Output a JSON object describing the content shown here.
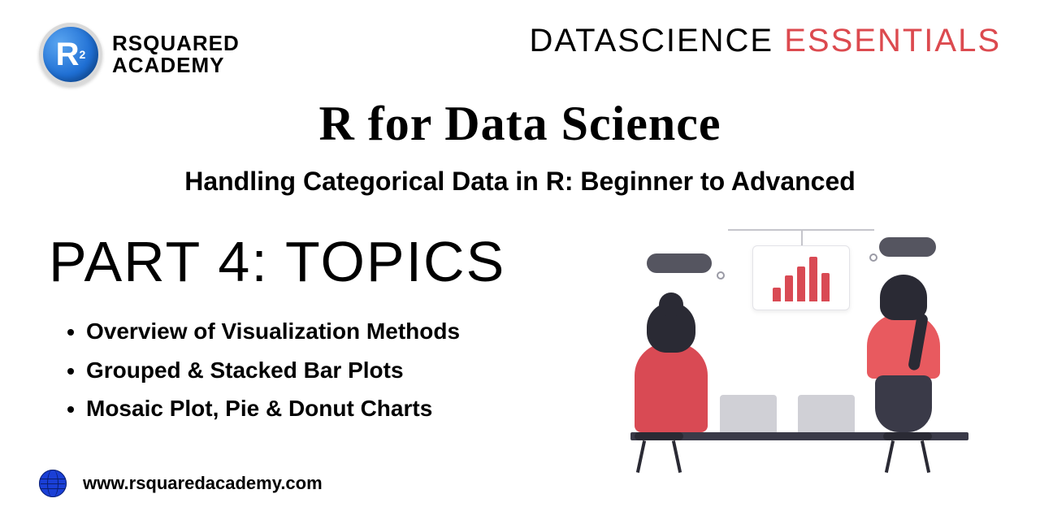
{
  "brand": {
    "logo_letter": "R",
    "logo_sup": "2",
    "line1": "RSQUARED",
    "line2": "ACADEMY"
  },
  "tagline": {
    "word1": "DATASCIENCE",
    "word2": "ESSENTIALS"
  },
  "title": "R for Data Science",
  "subtitle": "Handling Categorical Data in R: Beginner to Advanced",
  "part_heading": "Part 4: Topics",
  "topics": [
    "Overview of Visualization Methods",
    "Grouped & Stacked Bar Plots",
    "Mosaic Plot, Pie & Donut Charts"
  ],
  "footer_url": "www.rsquaredacademy.com"
}
